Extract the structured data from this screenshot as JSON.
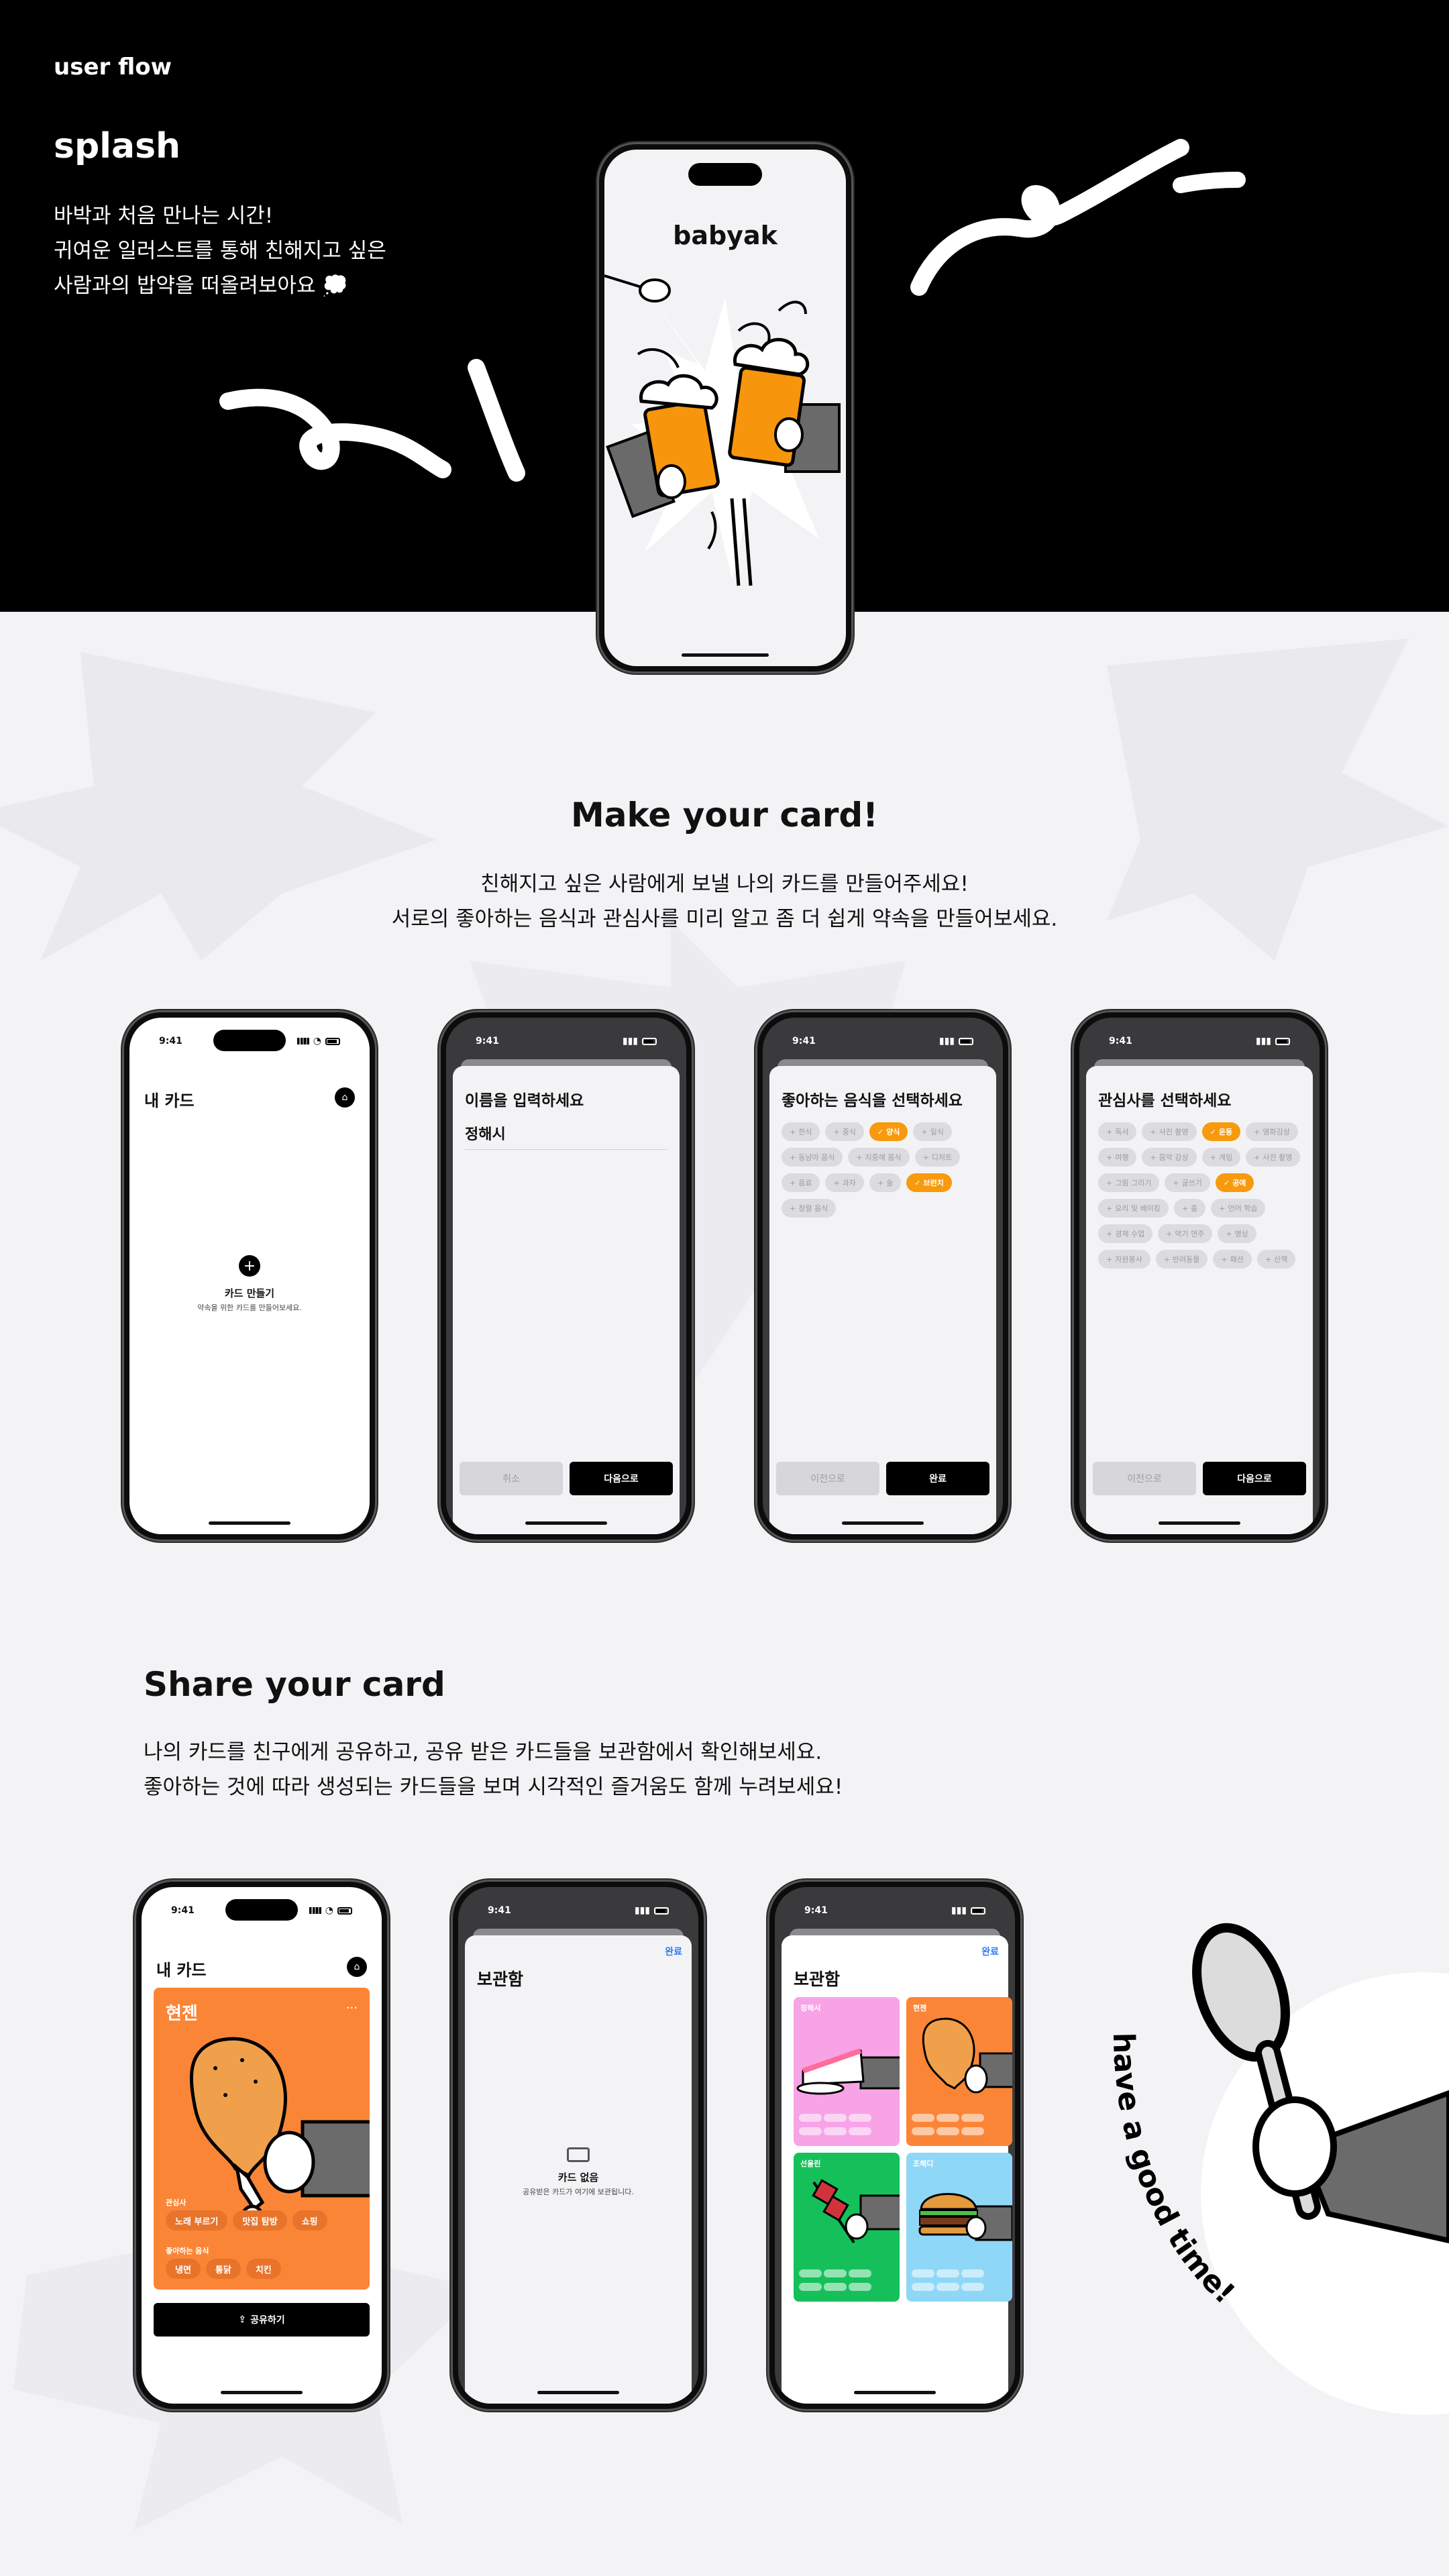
{
  "header": {
    "eyebrow": "user flow",
    "splash_title": "splash",
    "splash_desc": [
      "바박과 처음 만나는 시간!",
      "귀여운 일러스트를 통해 친해지고 싶은",
      "사람과의 밥약을 떠올려보아요 💭"
    ]
  },
  "splash_phone": {
    "logo": "babyak"
  },
  "make_section": {
    "title": "Make your card!",
    "desc": [
      "친해지고 싶은 사람에게 보낼 나의 카드를 만들어주세요!",
      "서로의 좋아하는 음식과 관심사를 미리 알고 좀 더 쉽게 약속을 만들어보세요."
    ]
  },
  "status_time": "9:41",
  "screen_mycard": {
    "title": "내 카드",
    "empty_title": "카드 만들기",
    "empty_sub": "약속을 위한 카드를 만들어보세요."
  },
  "screen_name": {
    "title": "이름을 입력하세요",
    "value": "정해시",
    "cancel": "취소",
    "next": "다음으로"
  },
  "screen_food": {
    "title": "좋아하는 음식을 선택하세요",
    "chips": [
      {
        "label": "한식",
        "selected": false
      },
      {
        "label": "중식",
        "selected": false
      },
      {
        "label": "양식",
        "selected": true
      },
      {
        "label": "일식",
        "selected": false
      },
      {
        "label": "동남아 음식",
        "selected": false
      },
      {
        "label": "지중해 음식",
        "selected": false
      },
      {
        "label": "디저트",
        "selected": false
      },
      {
        "label": "음료",
        "selected": false
      },
      {
        "label": "과자",
        "selected": false
      },
      {
        "label": "술",
        "selected": false
      },
      {
        "label": "브런치",
        "selected": true
      },
      {
        "label": "창렬 음식",
        "selected": false
      }
    ],
    "prev": "이전으로",
    "done": "완료"
  },
  "screen_interest": {
    "title": "관심사를 선택하세요",
    "chips": [
      {
        "label": "독서",
        "selected": false
      },
      {
        "label": "사진 촬영",
        "selected": false
      },
      {
        "label": "운동",
        "selected": true
      },
      {
        "label": "영화감상",
        "selected": false
      },
      {
        "label": "여행",
        "selected": false
      },
      {
        "label": "음악 감상",
        "selected": false
      },
      {
        "label": "게임",
        "selected": false
      },
      {
        "label": "사진 촬영",
        "selected": false
      },
      {
        "label": "그림 그리기",
        "selected": false
      },
      {
        "label": "글쓰기",
        "selected": false
      },
      {
        "label": "공예",
        "selected": true
      },
      {
        "label": "요리 및 베이킹",
        "selected": false
      },
      {
        "label": "춤",
        "selected": false
      },
      {
        "label": "언어 학습",
        "selected": false
      },
      {
        "label": "경제 수업",
        "selected": false
      },
      {
        "label": "악기 연주",
        "selected": false
      },
      {
        "label": "명상",
        "selected": false
      },
      {
        "label": "자원봉사",
        "selected": false
      },
      {
        "label": "반려동물",
        "selected": false
      },
      {
        "label": "패션",
        "selected": false
      },
      {
        "label": "산책",
        "selected": false
      }
    ],
    "prev": "이전으로",
    "next": "다음으로"
  },
  "share_section": {
    "title": "Share your card",
    "desc": [
      "나의 카드를 친구에게 공유하고, 공유 받은 카드들을 보관함에서 확인해보세요.",
      "좋아하는 것에 따라 생성되는 카드들을 보며 시각적인 즐거움도 함께 누려보세요!"
    ]
  },
  "screen_card": {
    "title": "내 카드",
    "card_name": "현젠",
    "more": "···",
    "interests_label": "관심사",
    "interests": [
      "노래 부르기",
      "맛집 탐방",
      "쇼핑"
    ],
    "foods_label": "좋아하는 음식",
    "foods": [
      "냉면",
      "통닭",
      "치킨"
    ],
    "share_button": "공유하기",
    "accent": "#fb8536"
  },
  "screen_storage_empty": {
    "done": "완료",
    "title": "보관함",
    "empty_title": "카드 없음",
    "empty_sub": "공유받은 카드가 여기에 보관됩니다."
  },
  "screen_storage": {
    "done": "완료",
    "title": "보관함",
    "cards": [
      {
        "name": "정해시",
        "color": "#f7a3e6"
      },
      {
        "name": "현젠",
        "color": "#fb8536"
      },
      {
        "name": "선율린",
        "color": "#15c05a"
      },
      {
        "name": "조해디",
        "color": "#8fd7f7"
      }
    ]
  },
  "deco": {
    "curved_text": "have a good time!"
  }
}
